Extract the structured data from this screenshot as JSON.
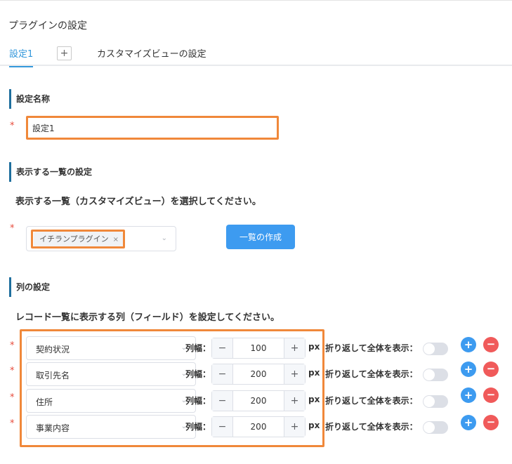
{
  "page": {
    "title": "プラグインの設定"
  },
  "tabs": [
    {
      "label": "設定1"
    },
    {
      "label": "+"
    },
    {
      "label": "カスタマイズビューの設定"
    }
  ],
  "name_section": {
    "heading": "設定名称",
    "required_mark": "*",
    "value": "設定1"
  },
  "list_section": {
    "heading": "表示する一覧の設定",
    "description": "表示する一覧（カスタマイズビュー）を選択してください。",
    "required_mark": "*",
    "selected_chip": "イチランプラグイン",
    "chip_remove": "×",
    "create_button": "一覧の作成"
  },
  "column_section": {
    "heading": "列の設定",
    "description": "レコード一覧に表示する列（フィールド）を設定してください。",
    "width_label": "列幅：",
    "unit": "px",
    "wrap_label": "折り返して全体を表示：",
    "rows": [
      {
        "required_mark": "*",
        "field": "契約状況",
        "width": "100",
        "wrap": false
      },
      {
        "required_mark": "*",
        "field": "取引先名",
        "width": "200",
        "wrap": false
      },
      {
        "required_mark": "*",
        "field": "住所",
        "width": "200",
        "wrap": false
      },
      {
        "required_mark": "*",
        "field": "事業内容",
        "width": "200",
        "wrap": false
      }
    ]
  },
  "icons": {
    "chevron": "chevron-down-icon",
    "minus": "−",
    "plus": "+",
    "add": "+",
    "remove": "−"
  },
  "colors": {
    "accent": "#3d9bf0",
    "danger": "#f05a5a",
    "highlight": "#f0883a",
    "required": "#e74c3c"
  }
}
